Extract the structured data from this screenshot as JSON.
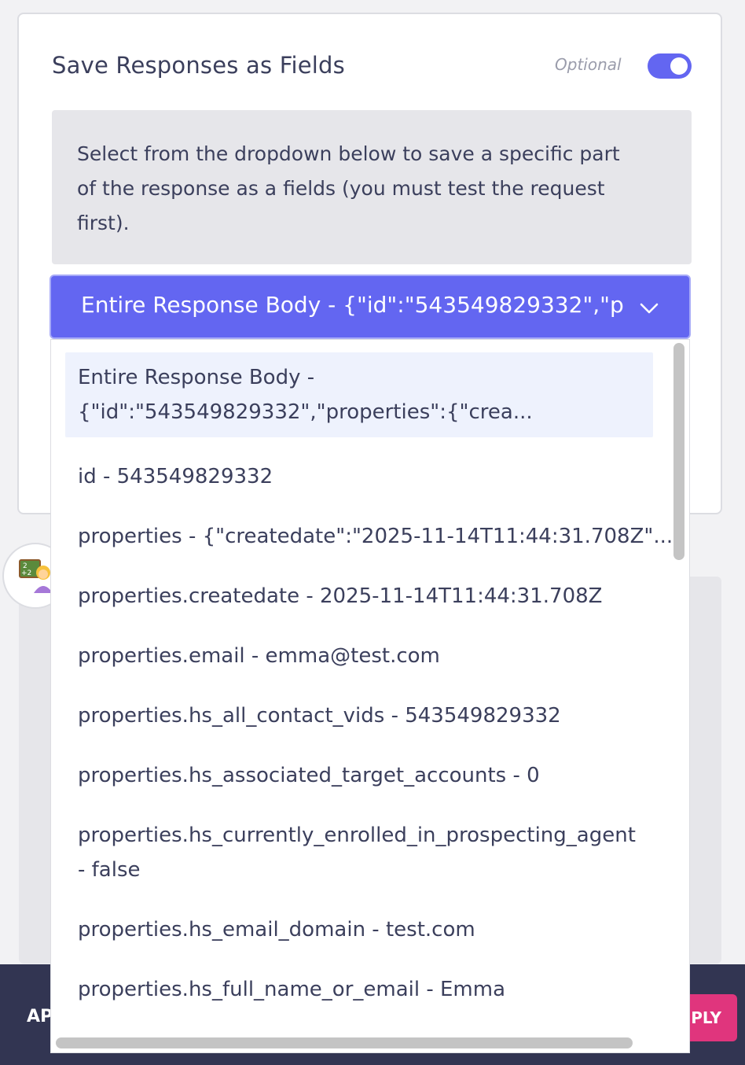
{
  "card": {
    "title": "Save Responses as Fields",
    "optional_label": "Optional",
    "toggle_on": true,
    "info_lines": [
      "Select from the dropdown below to save a specific part",
      "of the response as a fields (you must test the request",
      "first)."
    ]
  },
  "select": {
    "value": "Entire Response Body - {\"id\":\"543549829332\",\"p",
    "icon": "chevron-down-icon"
  },
  "dropdown": {
    "options": [
      {
        "line1": "Entire Response Body -",
        "line2": "{\"id\":\"543549829332\",\"properties\":{\"crea...",
        "selected": true
      },
      {
        "line1": "id - 543549829332"
      },
      {
        "line1": "properties - {\"createdate\":\"2025-11-14T11:44:31.708Z\"..."
      },
      {
        "line1": "properties.createdate - 2025-11-14T11:44:31.708Z"
      },
      {
        "line1": "properties.email - emma@test.com"
      },
      {
        "line1": "properties.hs_all_contact_vids - 543549829332"
      },
      {
        "line1": "properties.hs_associated_target_accounts - 0"
      },
      {
        "line1": "properties.hs_currently_enrolled_in_prospecting_agent",
        "line2": "- false"
      },
      {
        "line1": "properties.hs_email_domain - test.com"
      },
      {
        "line1": "properties.hs_full_name_or_email - Emma"
      }
    ]
  },
  "bottom_bar": {
    "left_text": "AP",
    "apply_label": "PLY"
  },
  "colors": {
    "accent": "#6366f1",
    "apply": "#e0357d",
    "bar": "#323552",
    "selected_option_bg": "#eef2fd"
  }
}
